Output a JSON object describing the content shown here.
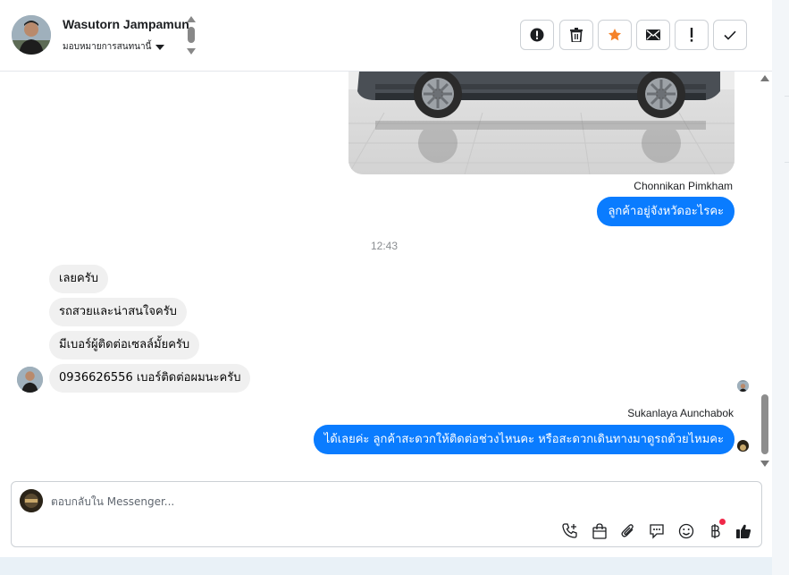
{
  "header": {
    "contact_name": "Wasutorn Jampamun",
    "assign_label": "มอบหมายการสนทนานี้",
    "actions": [
      {
        "name": "mark-spam-button",
        "icon": "alert-circle-icon"
      },
      {
        "name": "delete-button",
        "icon": "trash-icon"
      },
      {
        "name": "star-button",
        "icon": "star-icon",
        "color": "#f5822a"
      },
      {
        "name": "mark-unread-button",
        "icon": "envelope-icon"
      },
      {
        "name": "follow-up-button",
        "icon": "exclamation-icon"
      },
      {
        "name": "mark-done-button",
        "icon": "check-icon"
      }
    ]
  },
  "conversation": {
    "sender_1": "Chonnikan Pimkham",
    "outgoing_1": "ลูกค้าอยู่จังหวัดอะไรคะ",
    "timestamp": "12:43",
    "incoming": [
      "เลยครับ",
      "รถสวยและน่าสนใจครับ",
      "มีเบอร์ผู้ติดต่อเซลล์มั้ยครับ",
      "0936626556  เบอร์ติดต่อผมนะครับ"
    ],
    "sender_2": "Sukanlaya Aunchabok",
    "outgoing_2": "ได้เลยค่ะ ลูกค้าสะดวกให้ติดต่อช่วงไหนคะ หรือสะดวกเดินทางมาดูรถด้วยไหมคะ"
  },
  "composer": {
    "placeholder": "ตอบกลับใน Messenger...",
    "tools": [
      "phone-plus-icon",
      "shopping-bag-icon",
      "paperclip-icon",
      "chat-bubble-icon",
      "smiley-icon",
      "baht-icon",
      "thumbs-up-icon"
    ]
  },
  "colors": {
    "accent": "#0a7cff",
    "incoming_bubble": "#f0f0f0",
    "notification_dot": "#f02849"
  }
}
